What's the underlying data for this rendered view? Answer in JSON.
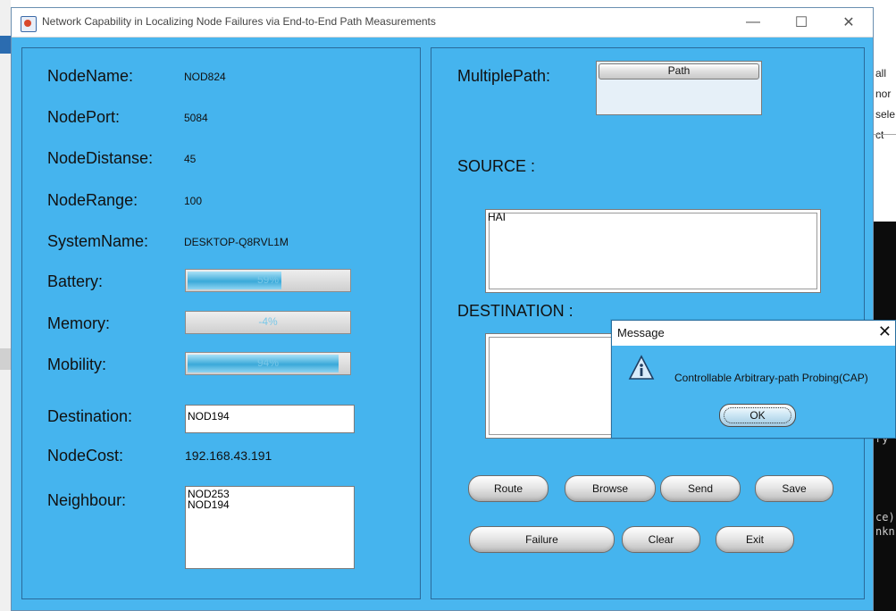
{
  "window": {
    "title": "Network Capability in Localizing Node Failures via End-to-End Path Measurements",
    "controls": {
      "minimize": "—",
      "maximize": "☐",
      "close": "✕"
    }
  },
  "background": {
    "right_texts": [
      "all",
      "nor",
      "sele",
      "ct"
    ],
    "console_texts": [
      "ce)",
      "nkn",
      "ry"
    ]
  },
  "left_panel": {
    "node_name": {
      "label": "NodeName:",
      "value": "NOD824"
    },
    "node_port": {
      "label": "NodePort:",
      "value": "5084"
    },
    "node_distance": {
      "label": "NodeDistanse:",
      "value": "45"
    },
    "node_range": {
      "label": "NodeRange:",
      "value": "100"
    },
    "system_name": {
      "label": "SystemName:",
      "value": "DESKTOP-Q8RVL1M"
    },
    "battery": {
      "label": "Battery:",
      "text": "59%",
      "percent": 59
    },
    "memory": {
      "label": "Memory:",
      "text": "-4%",
      "percent": -4
    },
    "mobility": {
      "label": "Mobility:",
      "text": "94%",
      "percent": 94
    },
    "destination": {
      "label": "Destination:",
      "value": "NOD194"
    },
    "node_cost": {
      "label": "NodeCost:",
      "value": "192.168.43.191"
    },
    "neighbour": {
      "label": "Neighbour:",
      "items": [
        "NOD253",
        "NOD194"
      ]
    }
  },
  "right_panel": {
    "multiple_path": {
      "label": "MultiplePath:",
      "column_header": "Path"
    },
    "source": {
      "label": "SOURCE :",
      "value": "HAI"
    },
    "destination": {
      "label": "DESTINATION :",
      "value": ""
    },
    "buttons": {
      "route": "Route",
      "browse": "Browse",
      "send": "Send",
      "save": "Save",
      "failure": "Failure",
      "clear": "Clear",
      "exit": "Exit"
    }
  },
  "dialog": {
    "title": "Message",
    "close": "✕",
    "message": "Controllable Arbitrary-path Probing(CAP)",
    "ok": "OK"
  }
}
